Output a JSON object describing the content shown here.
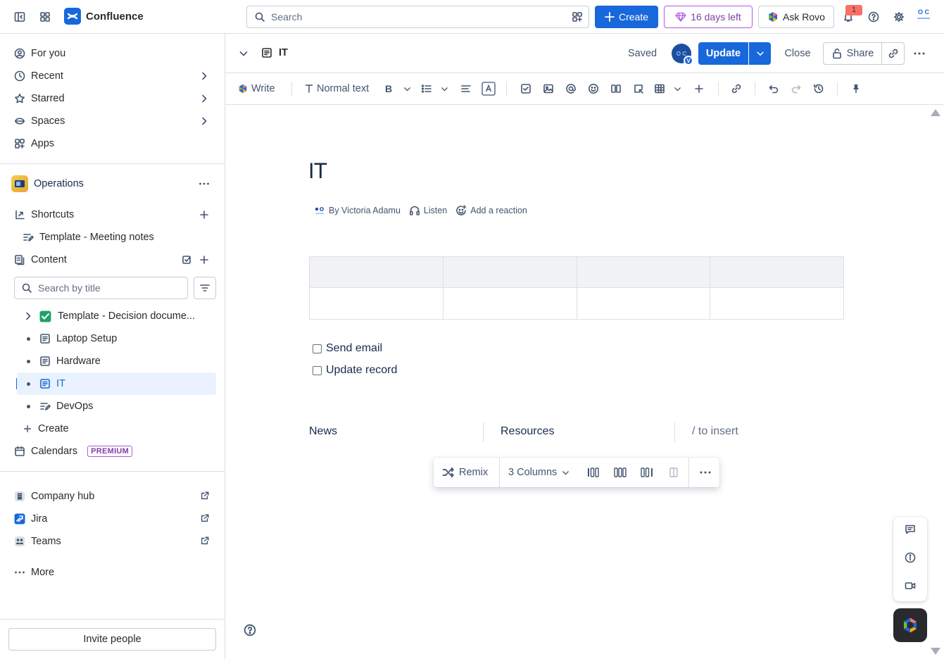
{
  "topbar": {
    "app_name": "Confluence",
    "search_placeholder": "Search",
    "create_label": "Create",
    "trial_label": "16 days left",
    "rovo_label": "Ask Rovo",
    "notification_count": "1",
    "org_avatar_text": "O C"
  },
  "sidebar": {
    "nav": [
      {
        "label": "For you",
        "icon": "user-circle-icon"
      },
      {
        "label": "Recent",
        "icon": "clock-icon"
      },
      {
        "label": "Starred",
        "icon": "star-icon"
      },
      {
        "label": "Spaces",
        "icon": "spaces-icon"
      },
      {
        "label": "Apps",
        "icon": "apps-icon"
      }
    ],
    "space_name": "Operations",
    "shortcuts_label": "Shortcuts",
    "shortcut_item": "Template - Meeting notes",
    "content_label": "Content",
    "search_placeholder": "Search by title",
    "tree": [
      {
        "label": "Template - Decision docume..."
      },
      {
        "label": "Laptop Setup"
      },
      {
        "label": "Hardware"
      },
      {
        "label": "IT"
      },
      {
        "label": "DevOps"
      }
    ],
    "tree_create_label": "Create",
    "calendars_label": "Calendars",
    "premium_badge": "PREMIUM",
    "links": [
      {
        "label": "Company hub"
      },
      {
        "label": "Jira"
      },
      {
        "label": "Teams"
      }
    ],
    "more_label": "More",
    "invite_label": "Invite people"
  },
  "header": {
    "breadcrumb_title": "IT",
    "status": "Saved",
    "avatar_text": "O C",
    "avatar_badge": "V",
    "update_label": "Update",
    "close_label": "Close",
    "share_label": "Share"
  },
  "toolbar": {
    "write_label": "Write",
    "text_style_label": "Normal text"
  },
  "page": {
    "title": "IT",
    "byline": "By Victoria Adamu",
    "listen_label": "Listen",
    "reaction_label": "Add a reaction",
    "tasks": [
      "Send email",
      "Update record"
    ],
    "columns": [
      "News",
      "Resources",
      "/ to insert"
    ]
  },
  "layout_toolbar": {
    "remix_label": "Remix",
    "columns_label": "3 Columns"
  },
  "colors": {
    "brand": "#1868DB",
    "trial": "#AF59E1",
    "active_bg": "#E9F2FE"
  }
}
